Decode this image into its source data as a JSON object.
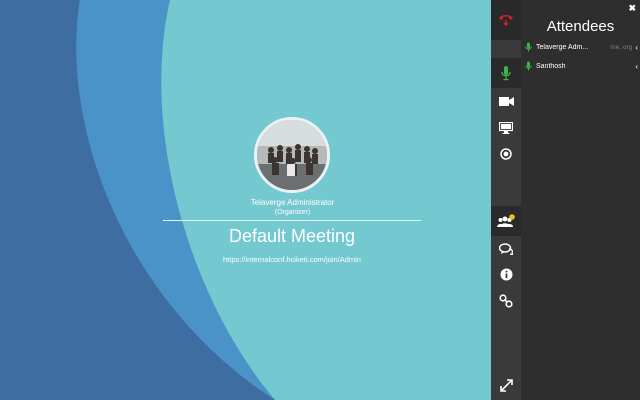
{
  "meeting": {
    "organizer_name": "Telaverge Administrator",
    "organizer_role": "(Organizer)",
    "title": "Default Meeting",
    "join_url": "https://internalconf.hciketi.com/join/Admin"
  },
  "toolbar": {
    "items": [
      {
        "icon": "hangup-icon",
        "color": "#d0202a"
      },
      {
        "icon": "microphone-icon",
        "color": "#3cb54a"
      },
      {
        "icon": "video-camera-icon",
        "color": "#ffffff"
      },
      {
        "icon": "screen-share-icon",
        "color": "#ffffff"
      },
      {
        "icon": "record-icon",
        "color": "#ffffff"
      },
      {
        "icon": "attendees-icon",
        "color": "#ffffff",
        "badge": ""
      },
      {
        "icon": "chat-icon",
        "color": "#ffffff"
      },
      {
        "icon": "info-icon",
        "color": "#ffffff"
      },
      {
        "icon": "link-icon",
        "color": "#ffffff"
      },
      {
        "icon": "fullscreen-icon",
        "color": "#ffffff"
      }
    ]
  },
  "panel": {
    "close_label": "✖",
    "title": "Attendees",
    "attendees": [
      {
        "name": "Telaverge Adm...",
        "tag": "me, org",
        "chevron": "‹"
      },
      {
        "name": "Santhosh",
        "tag": "",
        "chevron": "‹"
      }
    ]
  },
  "colors": {
    "background_dark": "#3e6ea1",
    "background_light": "#74c8d0",
    "accent_green": "#3cb54a",
    "hangup_red": "#d0202a",
    "badge_yellow": "#e6c41d"
  }
}
